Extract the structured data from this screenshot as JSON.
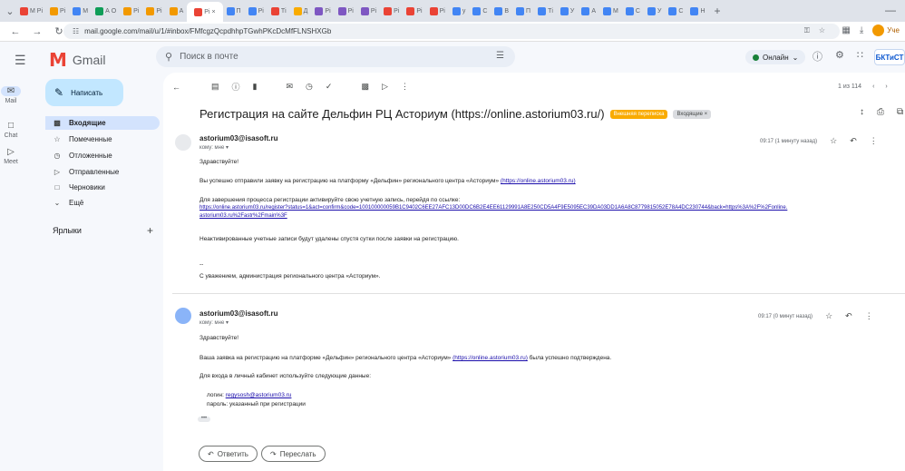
{
  "browser": {
    "tabs": [
      {
        "label": "М Рі",
        "color": "#ea4335"
      },
      {
        "label": "Рі",
        "color": "#f29900"
      },
      {
        "label": "М",
        "color": "#4285f4"
      },
      {
        "label": "А О",
        "color": "#0f9d58"
      },
      {
        "label": "Рі",
        "color": "#f29900"
      },
      {
        "label": "Рі",
        "color": "#f29900"
      },
      {
        "label": "А",
        "color": "#f29900"
      },
      {
        "label": "Рі ×",
        "color": "#ea4335",
        "active": true
      },
      {
        "label": "П",
        "color": "#4285f4"
      },
      {
        "label": "Рі",
        "color": "#4285f4"
      },
      {
        "label": "Ті",
        "color": "#ea4335"
      },
      {
        "label": "Д",
        "color": "#f9ab00"
      },
      {
        "label": "Рі",
        "color": "#7e57c2"
      },
      {
        "label": "Рі",
        "color": "#7e57c2"
      },
      {
        "label": "Рі",
        "color": "#7e57c2"
      },
      {
        "label": "Рі",
        "color": "#ea4335"
      },
      {
        "label": "Рі",
        "color": "#ea4335"
      },
      {
        "label": "Рі",
        "color": "#ea4335"
      },
      {
        "label": "у",
        "color": "#4285f4"
      },
      {
        "label": "С",
        "color": "#4285f4"
      },
      {
        "label": "В",
        "color": "#4285f4"
      },
      {
        "label": "П",
        "color": "#4285f4"
      },
      {
        "label": "Ті",
        "color": "#4285f4"
      },
      {
        "label": "У",
        "color": "#4285f4"
      },
      {
        "label": "А",
        "color": "#4285f4"
      },
      {
        "label": "М",
        "color": "#4285f4"
      },
      {
        "label": "С",
        "color": "#4285f4"
      },
      {
        "label": "У",
        "color": "#4285f4"
      },
      {
        "label": "С",
        "color": "#4285f4"
      },
      {
        "label": "Н",
        "color": "#4285f4"
      }
    ],
    "new_tab": "+",
    "url": "mail.google.com/mail/u/1/#inbox/FMfcgzQcpdhhpTGwhPKcDcMfFLNSHXGb",
    "profile_label": "Уче"
  },
  "gmail": {
    "app_name": "Gmail",
    "search_placeholder": "Поиск в почте",
    "status": "Онлайн",
    "account": "БКТиСТ",
    "rail": {
      "mail": "Mail",
      "chat": "Chat",
      "meet": "Meet"
    },
    "compose": "Написать",
    "nav": {
      "inbox": "Входящие",
      "starred": "Помеченные",
      "snoozed": "Отложенные",
      "sent": "Отправленные",
      "drafts": "Черновики",
      "more": "Ещё"
    },
    "labels_title": "Ярлыки",
    "pager": "1 из 114"
  },
  "thread": {
    "subject": "Регистрация на сайте Дельфин РЦ Асториум (https://online.astorium03.ru/)",
    "badge_external": "Внешняя переписка",
    "badge_inbox": "Входящие ×",
    "msg1": {
      "sender": "astorium03@isasoft.ru",
      "to": "кому: мне ▾",
      "time": "09:17 (1 минуту назад)",
      "greeting": "Здравствуйте!",
      "p1": "Вы успешно отправили заявку на регистрацию на платформу «Дельфин» регионального центра «Асториум»",
      "p1_link": "(https://online.astorium03.ru)",
      "p2": "Для завершения процесса регистрации активируйте свою учетную запись, перейдя по ссылке:",
      "p2_link_a": "https://online.astorium03.ru/register?status=1&act=confirm&code=100100000059B1C9402C6EE27AFC13D00DC6B2E4EE61129991A8E250CD5A4F9E5095EC39DA03DD1A6A8C8779815052E78A4DC230744&back=https%3A%2F%2Fonline.",
      "p2_link_b": "astorium03.ru%2Fastr%2Fmain%3F",
      "p3": "Неактивированные учетные записи будут удалены спустя сутки после заявки на регистрацию.",
      "sig_dash": "--",
      "signature": "С уважением, администрация регионального центра «Асториум»."
    },
    "msg2": {
      "sender": "astorium03@isasoft.ru",
      "to": "кому: мне ▾",
      "time": "09:17 (0 минут назад)",
      "greeting": "Здравствуйте!",
      "p1": "Ваша заявка на регистрацию на платформе «Дельфин» регионального центра «Асториум»",
      "p1_link": "(https://online.astorium03.ru)",
      "p1_tail": "была успешно подтверждена.",
      "p2": "Для входа в личный кабинет используйте следующие данные:",
      "login_label": "логин:",
      "login_value": "regysosh@astorium03.ru",
      "password": "пароль: указанный при регистрации",
      "more_dots": "•••"
    },
    "reply": "Ответить",
    "forward": "Переслать"
  }
}
